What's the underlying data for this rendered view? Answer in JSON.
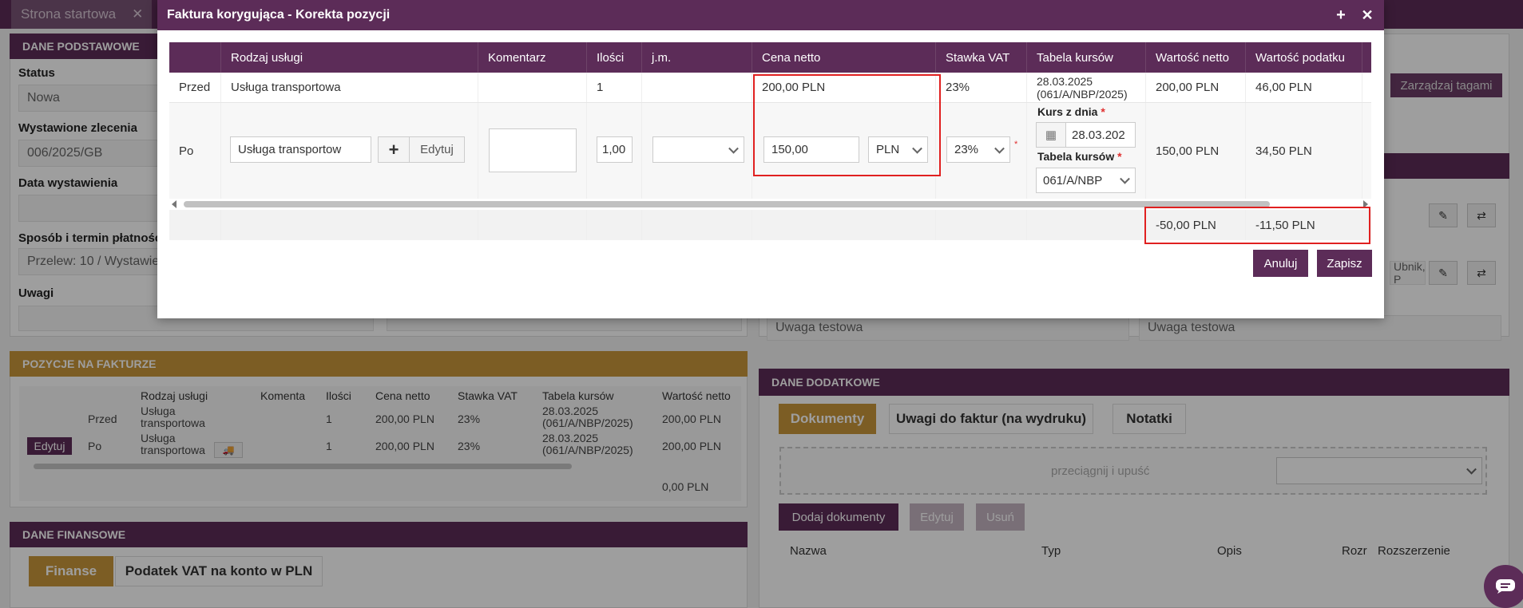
{
  "app": {
    "start_tab": "Strona startowa",
    "close_glyph": "✕"
  },
  "left_panel": {
    "header": "DANE PODSTAWOWE",
    "status_label": "Status",
    "status_value": "Nowa",
    "orders_label": "Wystawione zlecenia",
    "orders_value": "006/2025/GB",
    "issue_date_label": "Data wystawienia",
    "payment_label": "Sposób i termin płatności",
    "payment_value": "Przelew: 10 / Wystawien",
    "notes_label": "Uwagi"
  },
  "right_panel": {
    "manage_tags": "Zarządzaj tagami",
    "partial_value": "Ubnik, P",
    "note1": "Uwaga testowa",
    "note2": "Uwaga testowa"
  },
  "positions": {
    "header": "POZYCJE NA FAKTURZE",
    "columns": [
      "Rodzaj usługi",
      "Komenta",
      "Ilości",
      "Cena netto",
      "Stawka VAT",
      "Tabela kursów",
      "Wartość netto"
    ],
    "rows": [
      {
        "kind": "Przed",
        "service": "Usługa transportowa",
        "qty": "1",
        "price": "200,00 PLN",
        "vat": "23%",
        "table": "28.03.2025 (061/A/NBP/2025)",
        "net": "200,00 PLN"
      },
      {
        "kind": "Po",
        "service": "Usługa transportowa",
        "qty": "1",
        "price": "200,00 PLN",
        "vat": "23%",
        "table": "28.03.2025 (061/A/NBP/2025)",
        "net": "200,00 PLN"
      }
    ],
    "edit_label": "Edytuj",
    "total": "0,00 PLN"
  },
  "finance": {
    "header": "DANE FINANSOWE",
    "tab1": "Finanse",
    "tab2": "Podatek VAT na konto w PLN"
  },
  "extra": {
    "header": "DANE DODATKOWE",
    "tab1": "Dokumenty",
    "tab2": "Uwagi do faktur (na wydruku)",
    "tab3": "Notatki",
    "drop_text": "przeciągnij i upuść",
    "add_docs": "Dodaj dokumenty",
    "edit": "Edytuj",
    "delete": "Usuń",
    "columns": [
      "Nazwa",
      "Typ",
      "Opis",
      "Rozr",
      "Rozszerzenie"
    ]
  },
  "modal": {
    "title": "Faktura korygująca - Korekta pozycji",
    "columns": [
      "",
      "Rodzaj usługi",
      "Komentarz",
      "Ilości",
      "j.m.",
      "Cena netto",
      "Stawka VAT",
      "Tabela kursów",
      "Wartość netto",
      "Wartość podatku"
    ],
    "before": {
      "label": "Przed",
      "service": "Usługa transportowa",
      "qty": "1",
      "price": "200,00 PLN",
      "vat": "23%",
      "table": "28.03.2025 (061/A/NBP/2025)",
      "net": "200,00 PLN",
      "tax": "46,00 PLN"
    },
    "after": {
      "label": "Po",
      "service_input": "Usługa transportow",
      "edit_label": "Edytuj",
      "qty_input": "1,00",
      "price_input": "150,00",
      "currency": "PLN",
      "vat_select": "23%",
      "rate_date_label": "Kurs z dnia",
      "rate_date_value": "28.03.202",
      "rate_table_label": "Tabela kursów",
      "rate_table_value": "061/A/NBP",
      "net": "150,00 PLN",
      "tax": "34,50 PLN"
    },
    "diff": {
      "net": "-50,00 PLN",
      "tax": "-11,50 PLN"
    },
    "cancel": "Anuluj",
    "save": "Zapisz"
  }
}
